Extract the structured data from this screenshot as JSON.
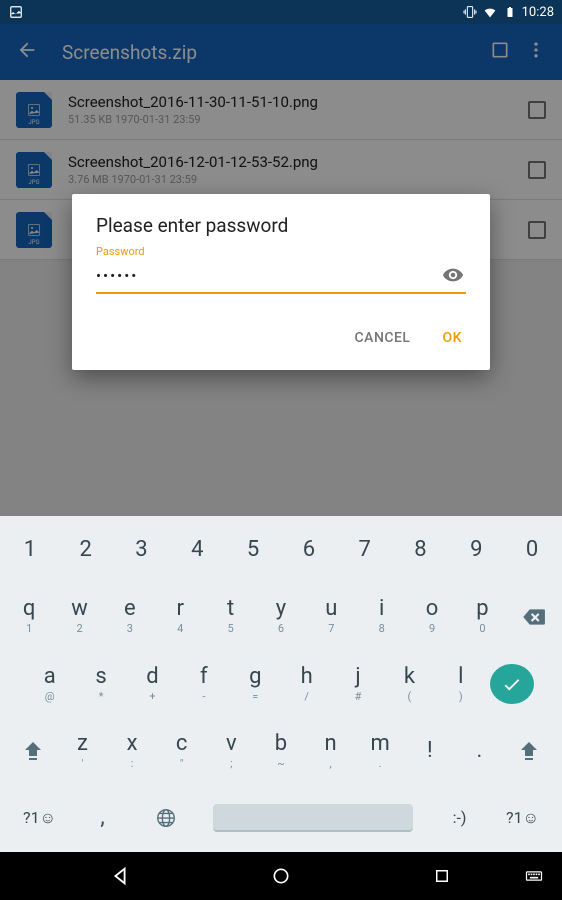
{
  "status_bar": {
    "time": "10:28"
  },
  "app_bar": {
    "title": "Screenshots.zip"
  },
  "files": [
    {
      "name": "Screenshot_2016-11-30-11-51-10.png",
      "meta": "51.35 KB  1970-01-31 23:59",
      "type": "JPG"
    },
    {
      "name": "Screenshot_2016-12-01-12-53-52.png",
      "meta": "3.76 MB  1970-01-31 23:59",
      "type": "JPG"
    },
    {
      "name": "",
      "meta": "",
      "type": "JPG"
    }
  ],
  "dialog": {
    "title": "Please enter password",
    "input_label": "Password",
    "input_value": "••••••",
    "cancel_label": "CANCEL",
    "ok_label": "OK"
  },
  "keyboard": {
    "numbers": [
      "1",
      "2",
      "3",
      "4",
      "5",
      "6",
      "7",
      "8",
      "9",
      "0"
    ],
    "row1": [
      {
        "main": "q",
        "sub": "1"
      },
      {
        "main": "w",
        "sub": "2"
      },
      {
        "main": "e",
        "sub": "3"
      },
      {
        "main": "r",
        "sub": "4"
      },
      {
        "main": "t",
        "sub": "5"
      },
      {
        "main": "y",
        "sub": "6"
      },
      {
        "main": "u",
        "sub": "7"
      },
      {
        "main": "i",
        "sub": "8"
      },
      {
        "main": "o",
        "sub": "9"
      },
      {
        "main": "p",
        "sub": "0"
      }
    ],
    "row2": [
      {
        "main": "a",
        "sub": "@"
      },
      {
        "main": "s",
        "sub": "*"
      },
      {
        "main": "d",
        "sub": "+"
      },
      {
        "main": "f",
        "sub": "-"
      },
      {
        "main": "g",
        "sub": "="
      },
      {
        "main": "h",
        "sub": "/"
      },
      {
        "main": "j",
        "sub": "#"
      },
      {
        "main": "k",
        "sub": "("
      },
      {
        "main": "l",
        "sub": ")"
      }
    ],
    "row3": [
      {
        "main": "z",
        "sub": "'"
      },
      {
        "main": "x",
        "sub": ":"
      },
      {
        "main": "c",
        "sub": "\""
      },
      {
        "main": "v",
        "sub": ";"
      },
      {
        "main": "b",
        "sub": "~"
      },
      {
        "main": "n",
        "sub": ","
      },
      {
        "main": "m",
        "sub": "."
      },
      {
        "main": "!",
        "sub": ""
      },
      {
        "main": ".",
        "sub": ""
      }
    ],
    "row4_left": "?1☺",
    "row4_comma": ",",
    "row4_emotic": ":-)",
    "row4_right": "?1☺"
  }
}
